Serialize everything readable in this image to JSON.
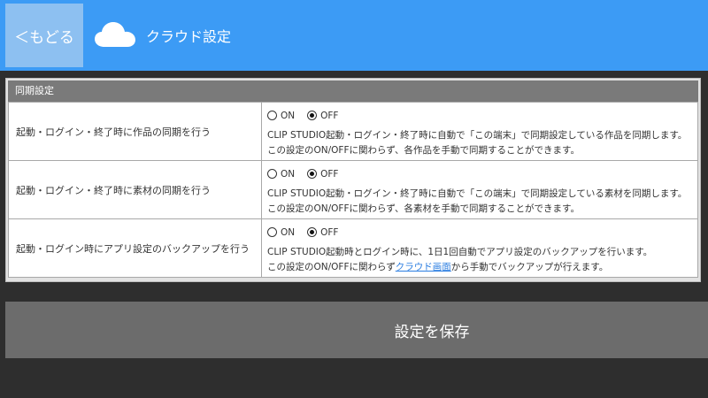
{
  "header": {
    "back_label": "＜もどる",
    "title": "クラウド設定",
    "icon": "cloud-icon"
  },
  "panel": {
    "title": "同期設定",
    "rows": [
      {
        "label": "起動・ログイン・終了時に作品の同期を行う",
        "on_label": "ON",
        "off_label": "OFF",
        "selected": "OFF",
        "desc1": "CLIP STUDIO起動・ログイン・終了時に自動で「この端末」で同期設定している作品を同期します。",
        "desc2": "この設定のON/OFFに関わらず、各作品を手動で同期することができます。"
      },
      {
        "label": "起動・ログイン・終了時に素材の同期を行う",
        "on_label": "ON",
        "off_label": "OFF",
        "selected": "OFF",
        "desc1": "CLIP STUDIO起動・ログイン・終了時に自動で「この端末」で同期設定している素材を同期します。",
        "desc2": "この設定のON/OFFに関わらず、各素材を手動で同期することができます。"
      },
      {
        "label": "起動・ログイン時にアプリ設定のバックアップを行う",
        "on_label": "ON",
        "off_label": "OFF",
        "selected": "OFF",
        "desc1": "CLIP STUDIO起動時とログイン時に、1日1回自動でアプリ設定のバックアップを行います。",
        "desc2_pre": "この設定のON/OFFに関わらず",
        "desc2_link": "クラウド画面",
        "desc2_post": "から手動でバックアップが行えます。"
      }
    ]
  },
  "save": {
    "label": "設定を保存"
  },
  "colors": {
    "header_bg": "#3c9bf5",
    "back_bg": "#8dc0f1",
    "page_bg": "#2e2e2e",
    "save_bg": "#6c6c6c",
    "link": "#2a7de1"
  }
}
